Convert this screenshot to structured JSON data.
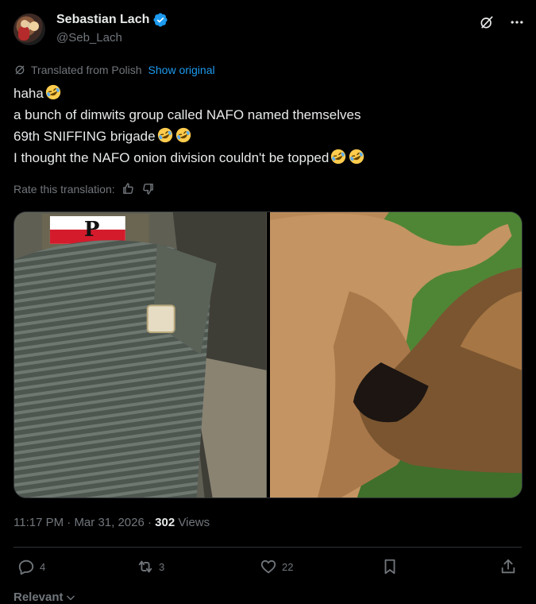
{
  "author": {
    "display_name": "Sebastian Lach",
    "handle": "@Seb_Lach",
    "verified": true,
    "verified_color": "#1d9bf0"
  },
  "header_icons": [
    "grok-icon",
    "more-icon"
  ],
  "translation": {
    "label": "Translated from Polish",
    "show_original": "Show original",
    "rate_label": "Rate this translation:"
  },
  "tweet": {
    "lines": [
      "haha",
      "a bunch of dimwits group called NAFO named themselves",
      "69th SNIFFING brigade",
      "I thought the NAFO onion division couldn't be topped"
    ],
    "emoji": "rolling-on-floor-laughing"
  },
  "media": {
    "images": [
      "beanie-photo",
      "dog-sniffing-photo"
    ]
  },
  "meta": {
    "time": "11:17 PM",
    "date": "Mar 31, 2026",
    "views_count": "302",
    "views_label": "Views"
  },
  "actions": {
    "replies": "4",
    "reposts": "3",
    "likes": "22"
  },
  "sort": {
    "label": "Relevant"
  },
  "colors": {
    "background": "#000000",
    "text": "#e7e9ea",
    "muted": "#71767b",
    "accent": "#1d9bf0",
    "border": "#2f3336"
  }
}
